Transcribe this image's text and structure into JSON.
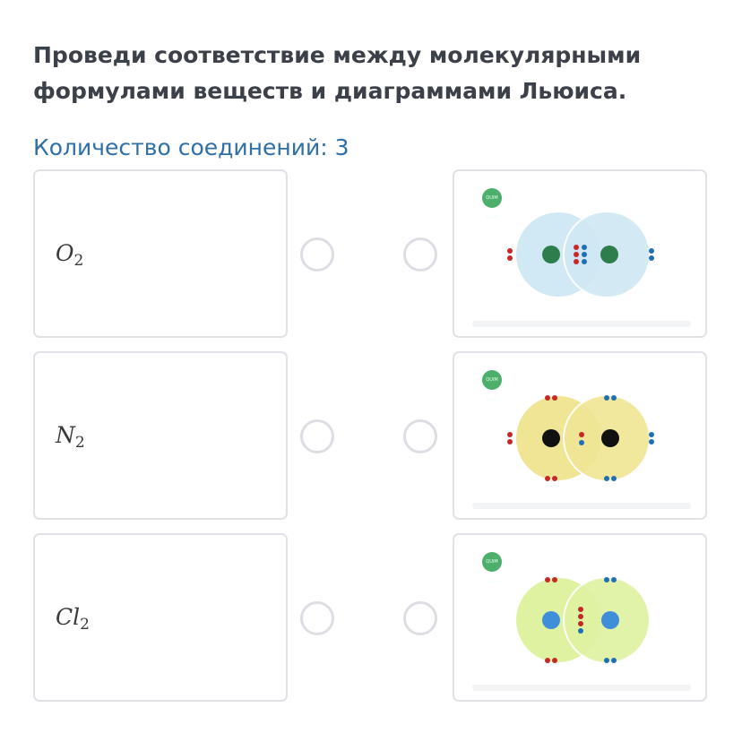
{
  "question": {
    "title": "Проведи соответствие между молекулярными формулами веществ и диаграммами Льюиса.",
    "count_label": "Количество соединений: 3"
  },
  "left_items": [
    {
      "element": "O",
      "subscript": "2"
    },
    {
      "element": "N",
      "subscript": "2"
    },
    {
      "element": "Cl",
      "subscript": "2"
    }
  ],
  "right_items": [
    {
      "badge": "QUIM Land",
      "fill": "#cfe8f4",
      "stroke": "#aad5ea",
      "nucleus": "#2e7d4c"
    },
    {
      "badge": "QUIM Land",
      "fill": "#f0e595",
      "stroke": "#e5d470",
      "nucleus": "#111111"
    },
    {
      "badge": "QUIM Land",
      "fill": "#dff2a2",
      "stroke": "#c9e57d",
      "nucleus": "#3e8ed9"
    }
  ],
  "colors": {
    "title": "#3c4049",
    "count": "#2f6fa8",
    "card_border": "#e0e2e8",
    "radio_border": "#dcdee4",
    "electron_red": "#c62828",
    "electron_blue": "#1e6fb8"
  }
}
